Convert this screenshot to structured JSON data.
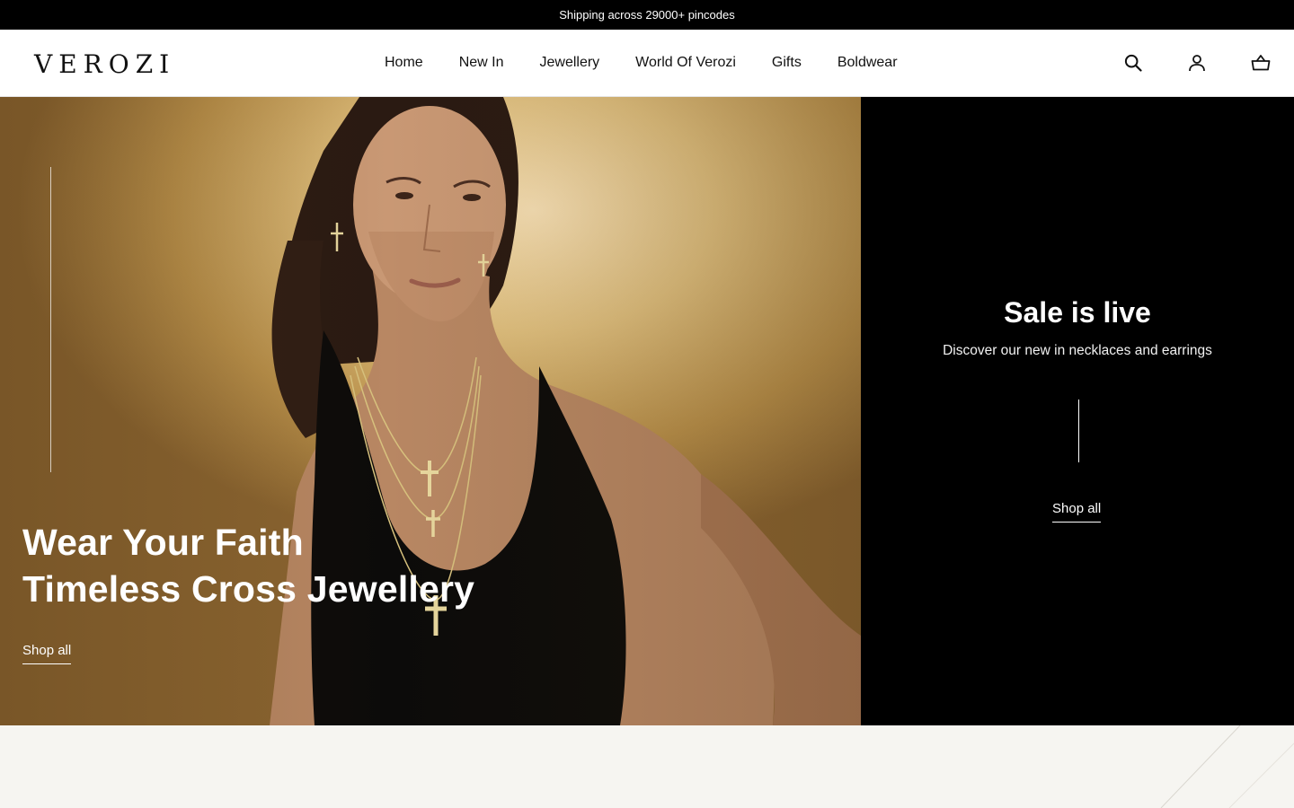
{
  "announcement": {
    "text": "Shipping across 29000+ pincodes"
  },
  "header": {
    "logo": "VEROZI",
    "nav": [
      "Home",
      "New In",
      "Jewellery",
      "World Of Verozi",
      "Gifts",
      "Boldwear"
    ],
    "icons": {
      "search": "search-icon",
      "account": "user-icon",
      "cart": "cart-icon"
    }
  },
  "hero": {
    "title_line1": "Wear Your Faith",
    "title_line2": "Timeless Cross Jewellery",
    "cta": "Shop all"
  },
  "promo": {
    "title": "Sale is live",
    "subtitle": "Discover our new in necklaces and earrings",
    "cta": "Shop all"
  },
  "colors": {
    "topbar": "#000000",
    "promo_bg": "#000000",
    "page_bg": "#f6f5f1",
    "hero_gold": "#dfbf7e"
  }
}
